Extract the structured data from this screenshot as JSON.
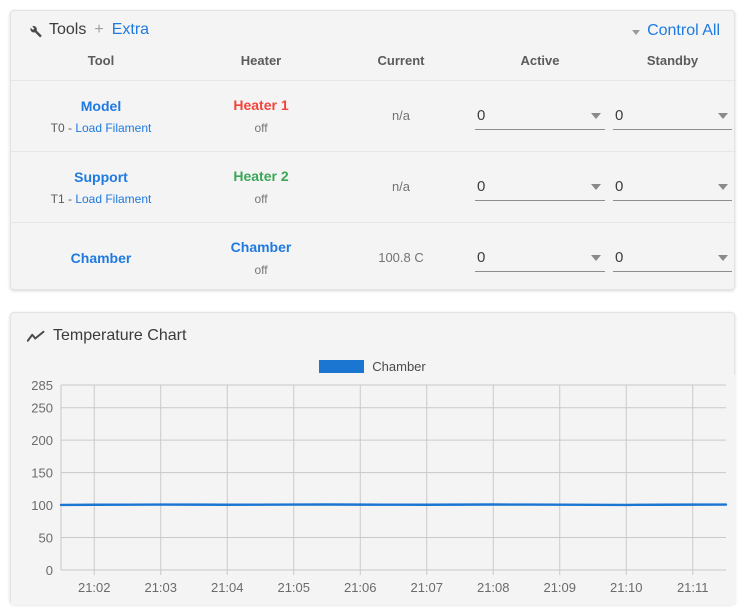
{
  "tools_panel": {
    "icon": "wrench-icon",
    "title": "Tools",
    "plus": "+",
    "extra_link": "Extra",
    "control_all": "Control All",
    "control_all_caret": "caret-down-icon",
    "columns": [
      "Tool",
      "Heater",
      "Current",
      "Active",
      "Standby"
    ],
    "rows": [
      {
        "tool_name": "Model",
        "tool_prefix": "T0 - ",
        "tool_action": "Load Filament",
        "heater_name": "Heater 1",
        "heater_color": "#f4433a",
        "heater_state": "off",
        "current": "n/a",
        "active": "0",
        "standby": "0"
      },
      {
        "tool_name": "Support",
        "tool_prefix": "T1 - ",
        "tool_action": "Load Filament",
        "heater_name": "Heater 2",
        "heater_color": "#3aa757",
        "heater_state": "off",
        "current": "n/a",
        "active": "0",
        "standby": "0"
      },
      {
        "tool_name": "Chamber",
        "tool_prefix": "",
        "tool_action": "",
        "heater_name": "Chamber",
        "heater_color": "#1f7ae0",
        "heater_state": "off",
        "current": "100.8 C",
        "active": "0",
        "standby": "0"
      }
    ]
  },
  "chart_panel": {
    "icon": "line-chart-icon",
    "title": "Temperature Chart"
  },
  "colors": {
    "accent_blue": "#1f7ae0",
    "series_blue": "#1b76d2",
    "red": "#f4433a",
    "green": "#3aa757",
    "card_bg": "#f4f4f4",
    "grid": "#c9c9c9"
  },
  "chart_data": {
    "type": "line",
    "title": "Temperature Chart",
    "xlabel": "",
    "ylabel": "",
    "grid": true,
    "legend_position": "top-center",
    "ylim": [
      0,
      285
    ],
    "yticks": [
      0,
      50,
      100,
      150,
      200,
      250,
      285
    ],
    "xticks": [
      "21:02",
      "21:03",
      "21:04",
      "21:05",
      "21:06",
      "21:07",
      "21:08",
      "21:09",
      "21:10",
      "21:11"
    ],
    "series": [
      {
        "name": "Chamber",
        "color": "#1b76d2",
        "x": [
          "21:01:30",
          "21:02:00",
          "21:02:30",
          "21:03:00",
          "21:03:30",
          "21:04:00",
          "21:04:30",
          "21:05:00",
          "21:05:30",
          "21:06:00",
          "21:06:30",
          "21:07:00",
          "21:07:30",
          "21:08:00",
          "21:08:30",
          "21:09:00",
          "21:09:30",
          "21:10:00",
          "21:10:30",
          "21:11:00",
          "21:11:30"
        ],
        "values": [
          100.3,
          100.5,
          100.6,
          100.8,
          100.7,
          100.5,
          100.6,
          100.8,
          100.9,
          100.7,
          100.6,
          100.5,
          100.7,
          100.9,
          100.8,
          100.6,
          100.4,
          100.3,
          100.5,
          100.7,
          100.8
        ]
      }
    ]
  }
}
